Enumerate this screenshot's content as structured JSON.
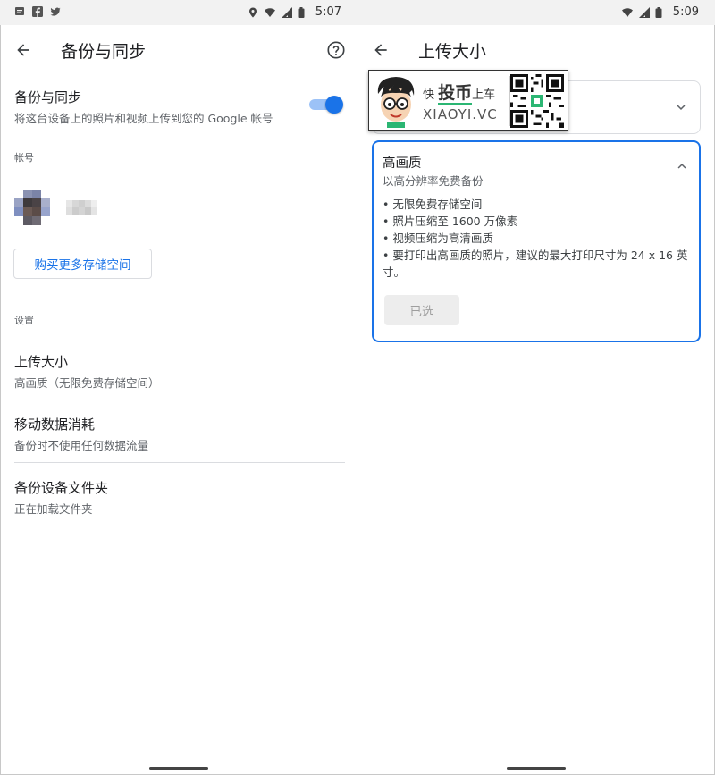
{
  "left": {
    "status": {
      "time": "5:07"
    },
    "title": "备份与同步",
    "backup_sync": {
      "title": "备份与同步",
      "subtitle": "将这台设备上的照片和视频上传到您的 Google 帐号",
      "enabled": true
    },
    "account_section_label": "帐号",
    "buy_storage_label": "购买更多存储空间",
    "settings_section_label": "设置",
    "settings": [
      {
        "title": "上传大小",
        "subtitle": "高画质（无限免费存储空间）"
      },
      {
        "title": "移动数据消耗",
        "subtitle": "备份时不使用任何数据流量"
      },
      {
        "title": "备份设备文件夹",
        "subtitle": "正在加载文件夹"
      }
    ]
  },
  "right": {
    "status": {
      "time": "5:09"
    },
    "title": "上传大小",
    "high_quality": {
      "title": "高画质",
      "subtitle": "以高分辨率免费备份",
      "bullets": [
        "• 无限免费存储空间",
        "• 照片压缩至 1600 万像素",
        "• 视频压缩为高清画质",
        "• 要打印出高画质的照片，建议的最大打印尺寸为 24 x 16 英寸。"
      ],
      "selected_label": "已选"
    }
  },
  "watermark": {
    "line1_a": "快",
    "line1_b": "投币",
    "line1_c": "上车",
    "line2": "XIAOYI.VC"
  },
  "colors": {
    "accent": "#1a73e8",
    "toggle_track": "#9cc2f7",
    "divider": "#dadce0",
    "secondary_text": "#5f6368"
  },
  "icons": {
    "back": "arrow-left-icon",
    "help": "help-circle-icon",
    "chevron_down": "chevron-down-icon",
    "chevron_up": "chevron-up-icon",
    "wifi": "wifi-icon",
    "signal": "signal-icon",
    "battery": "battery-icon",
    "location": "location-icon"
  }
}
